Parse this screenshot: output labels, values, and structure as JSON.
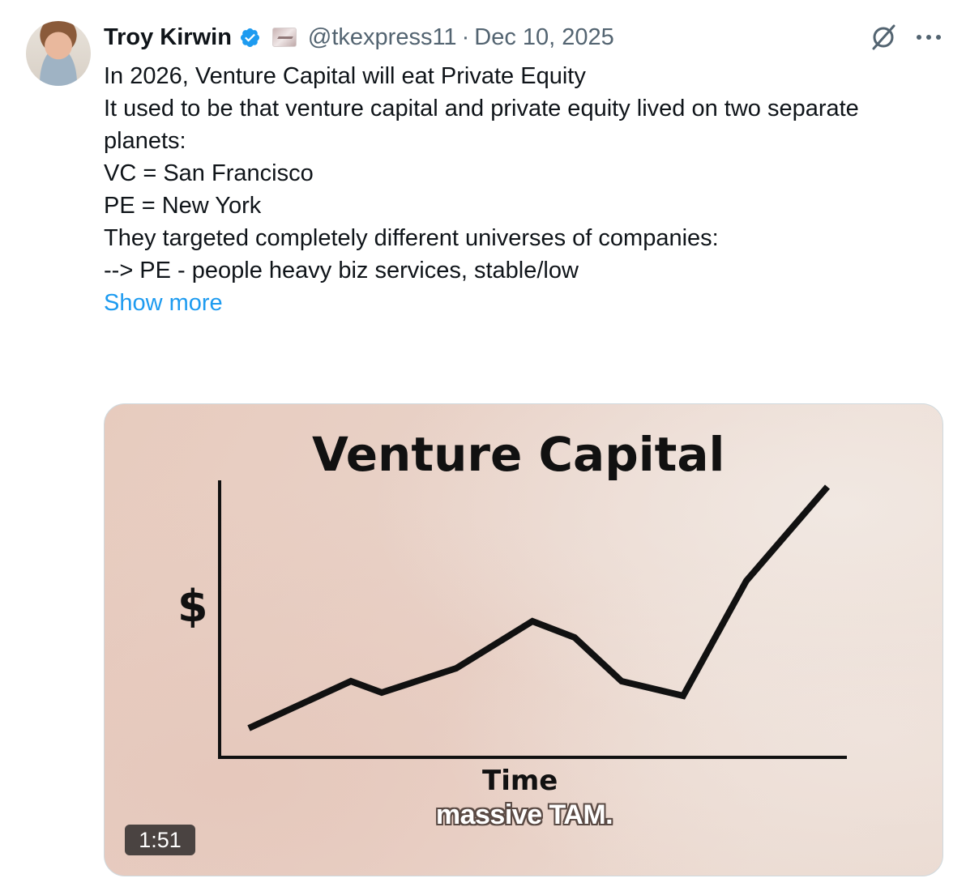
{
  "author": {
    "name": "Troy Kirwin",
    "handle": "@tkexpress11",
    "separator": "·",
    "date": "Dec 10, 2025",
    "verified_color": "#1d9bf0"
  },
  "icons": {
    "avatar": "profile-photo",
    "verified": "verified-badge-icon",
    "affiliation": "affiliate-logo-icon",
    "grok": "grok-icon",
    "more": "more-options-icon"
  },
  "text": {
    "line1": "In 2026, Venture Capital will eat Private Equity",
    "line2": "It used to be that venture capital and private equity lived on two separate",
    "line3": "planets:",
    "line4": "VC = San Francisco",
    "line5": "PE = New York",
    "line6": "They targeted completely different universes of companies:",
    "line7": "--> PE - people heavy biz services, stable/low",
    "show_more": "Show more"
  },
  "video": {
    "duration": "1:51",
    "caption": "massive TAM.",
    "chart_title": "Venture Capital",
    "y_label": "$",
    "x_label": "Time"
  },
  "colors": {
    "link": "#1d9bf0",
    "secondary_text": "#536471",
    "text": "#0f1419"
  }
}
